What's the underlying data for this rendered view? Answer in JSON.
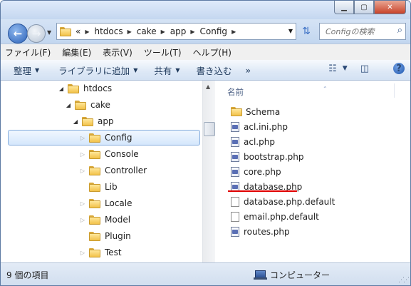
{
  "window": {
    "caption_buttons": [
      "minimize",
      "maximize",
      "close"
    ]
  },
  "address": {
    "overflow": "«",
    "crumbs": [
      "htdocs",
      "cake",
      "app",
      "Config"
    ]
  },
  "search": {
    "placeholder": "Configの検索"
  },
  "menu": [
    "ファイル(F)",
    "編集(E)",
    "表示(V)",
    "ツール(T)",
    "ヘルプ(H)"
  ],
  "toolbar": {
    "organize": "整理",
    "include_library": "ライブラリに追加",
    "share": "共有",
    "burn": "書き込む",
    "more": "»"
  },
  "tree": [
    {
      "label": "htdocs",
      "expander": "open",
      "selected": false
    },
    {
      "label": "cake",
      "expander": "open",
      "selected": false
    },
    {
      "label": "app",
      "expander": "open",
      "selected": false
    },
    {
      "label": "Config",
      "expander": "closed",
      "selected": true
    },
    {
      "label": "Console",
      "expander": "closed",
      "selected": false
    },
    {
      "label": "Controller",
      "expander": "closed",
      "selected": false
    },
    {
      "label": "Lib",
      "expander": "none",
      "selected": false
    },
    {
      "label": "Locale",
      "expander": "closed",
      "selected": false
    },
    {
      "label": "Model",
      "expander": "closed",
      "selected": false
    },
    {
      "label": "Plugin",
      "expander": "none",
      "selected": false
    },
    {
      "label": "Test",
      "expander": "closed",
      "selected": false
    }
  ],
  "files": {
    "column_name": "名前",
    "items": [
      {
        "name": "Schema",
        "type": "folder"
      },
      {
        "name": "acl.ini.php",
        "type": "php"
      },
      {
        "name": "acl.php",
        "type": "php"
      },
      {
        "name": "bootstrap.php",
        "type": "php"
      },
      {
        "name": "core.php",
        "type": "php"
      },
      {
        "name": "database.php",
        "type": "php",
        "highlighted": true
      },
      {
        "name": "database.php.default",
        "type": "doc"
      },
      {
        "name": "email.php.default",
        "type": "doc"
      },
      {
        "name": "routes.php",
        "type": "php"
      }
    ]
  },
  "status": {
    "item_count": "9 個の項目",
    "location": "コンピューター"
  },
  "colors": {
    "highlight_underline": "#e00000",
    "selection": "#d5e7fc",
    "frame": "#c9daf0"
  }
}
